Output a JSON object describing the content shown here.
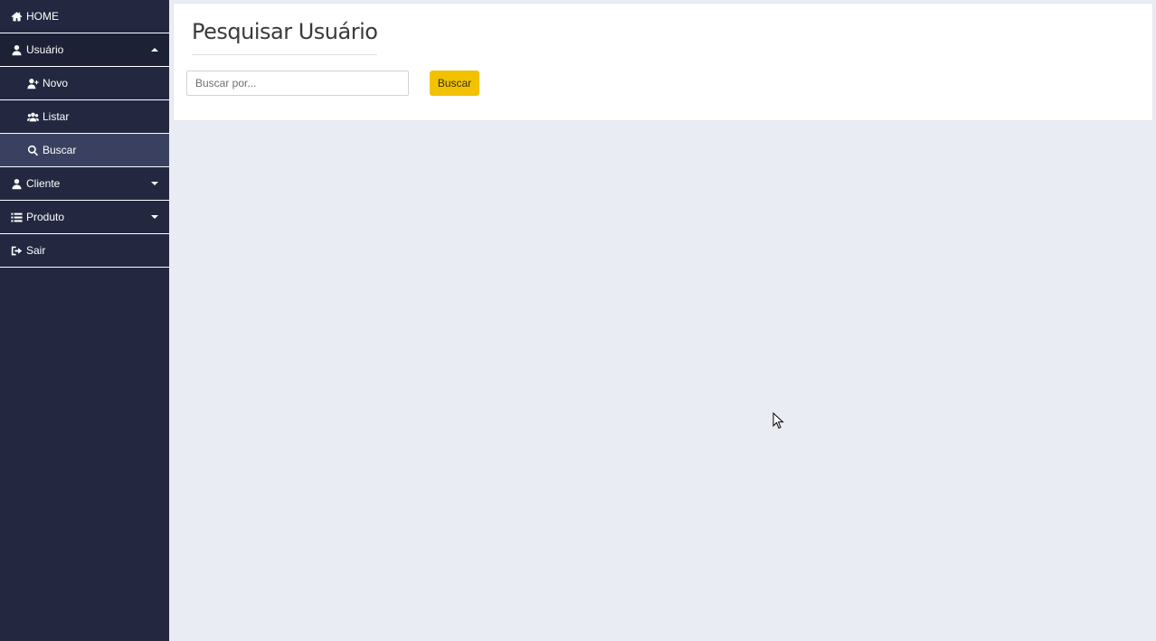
{
  "sidebar": {
    "items": [
      {
        "label": "HOME",
        "icon": "home-icon"
      },
      {
        "label": "Usuário",
        "icon": "user-icon"
      },
      {
        "label": "Novo",
        "icon": "user-plus-icon"
      },
      {
        "label": "Listar",
        "icon": "users-icon"
      },
      {
        "label": "Buscar",
        "icon": "search-icon"
      },
      {
        "label": "Cliente",
        "icon": "user-icon"
      },
      {
        "label": "Produto",
        "icon": "list-icon"
      },
      {
        "label": "Sair",
        "icon": "sign-out-icon"
      }
    ]
  },
  "main": {
    "title": "Pesquisar Usuário",
    "search": {
      "placeholder": "Buscar por...",
      "value": ""
    },
    "button_label": "Buscar"
  },
  "colors": {
    "sidebar_bg": "#232840",
    "active_bg": "#3a4160",
    "content_bg": "#e9ecf3",
    "accent": "#f2c200"
  }
}
